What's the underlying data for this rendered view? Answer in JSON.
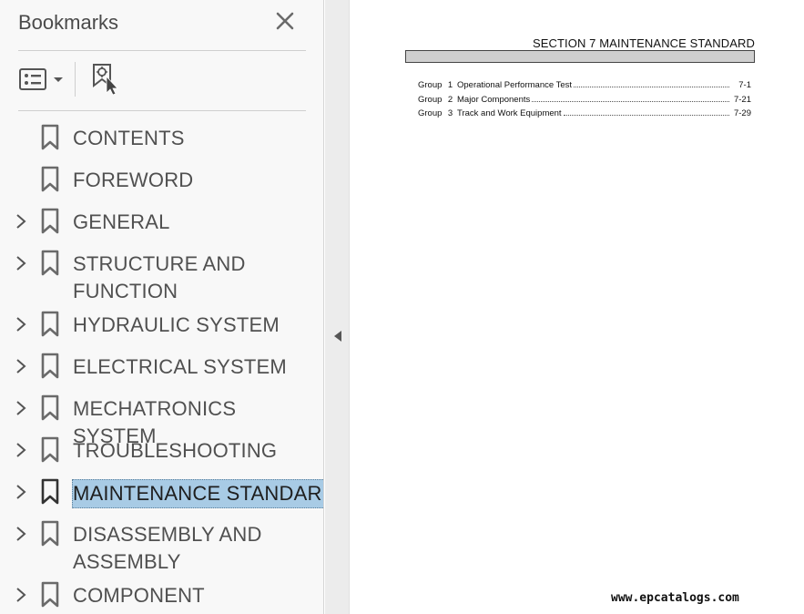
{
  "bookmarks_panel": {
    "title": "Bookmarks",
    "items": [
      {
        "label": "CONTENTS",
        "expandable": false,
        "selected": false
      },
      {
        "label": "FOREWORD",
        "expandable": false,
        "selected": false
      },
      {
        "label": "GENERAL",
        "expandable": true,
        "selected": false
      },
      {
        "label": "STRUCTURE AND\nFUNCTION",
        "expandable": true,
        "selected": false
      },
      {
        "label": "HYDRAULIC SYSTEM",
        "expandable": true,
        "selected": false
      },
      {
        "label": "ELECTRICAL SYSTEM",
        "expandable": true,
        "selected": false
      },
      {
        "label": "MECHATRONICS SYSTEM",
        "expandable": true,
        "selected": false
      },
      {
        "label": "TROUBLESHOOTING",
        "expandable": true,
        "selected": false
      },
      {
        "label": "MAINTENANCE STANDARD",
        "expandable": true,
        "selected": true
      },
      {
        "label": "DISASSEMBLY AND\nASSEMBLY",
        "expandable": true,
        "selected": false
      },
      {
        "label": "COMPONENT MOUNTING",
        "expandable": true,
        "selected": false
      }
    ],
    "icons": {
      "close": "close-icon",
      "options": "list-options-icon",
      "new_bookmark": "new-bookmark-icon",
      "bookmark": "bookmark-icon",
      "expand": "chevron-right-icon",
      "collapse_panel": "triangle-left-icon"
    },
    "colors": {
      "selection": "#a8cbe5",
      "panel_bg": "#f8f8f8",
      "text": "#505050"
    }
  },
  "document": {
    "section_title": "SECTION  7  MAINTENANCE STANDARD",
    "toc": [
      {
        "group": "Group",
        "num": "1",
        "name": "Operational Performance Test",
        "page": "7-1"
      },
      {
        "group": "Group",
        "num": "2",
        "name": "Major Components",
        "page": "7-21"
      },
      {
        "group": "Group",
        "num": "3",
        "name": "Track and Work Equipment",
        "page": "7-29"
      }
    ],
    "watermark": "www.epcatalogs.com"
  }
}
